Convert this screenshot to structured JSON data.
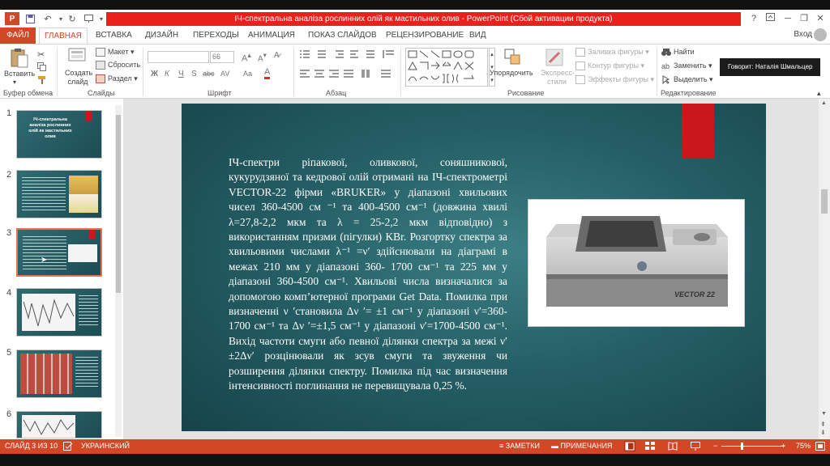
{
  "window": {
    "title": "ІЧ-спектральна аналіза рослинних олій як мастильних олив - PowerPoint (Сбой активации продукта)",
    "help": "?",
    "minimize": "─",
    "restore": "❐",
    "close": "✕"
  },
  "quick_access": {
    "save": "💾",
    "undo": "↶",
    "redo": "↻",
    "start": "▣"
  },
  "tabs": [
    "ФАЙЛ",
    "ГЛАВНАЯ",
    "ВСТАВКА",
    "ДИЗАЙН",
    "ПЕРЕХОДЫ",
    "АНИМАЦИЯ",
    "ПОКАЗ СЛАЙДОВ",
    "РЕЦЕНЗИРОВАНИЕ",
    "ВИД"
  ],
  "active_tab": "ГЛАВНАЯ",
  "login": "Вход",
  "ribbon": {
    "clipboard": {
      "paste": "Вставить",
      "group": "Буфер обмена"
    },
    "slides": {
      "new_slide": "Создать слайд",
      "layout": "Макет",
      "reset": "Сбросить",
      "section": "Раздел",
      "group": "Слайды"
    },
    "font": {
      "font_name": "",
      "font_size": "66",
      "bold": "Ж",
      "italic": "К",
      "underline": "Ч",
      "shadow": "S",
      "strike": "abc",
      "spacing": "AV",
      "case": "Aa",
      "color": "A",
      "group": "Шрифт"
    },
    "paragraph": {
      "group": "Абзац"
    },
    "drawing": {
      "arrange": "Упорядочить",
      "quick_styles": "Экспресс-стили",
      "fill": "Заливка фигуры",
      "outline": "Контур фигуры",
      "effects": "Эффекты фигуры",
      "group": "Рисование"
    },
    "editing": {
      "find": "Найти",
      "replace": "Заменить",
      "select": "Выделить",
      "group": "Редактирование"
    }
  },
  "tooltip": "Говорит: Наталія Шмальцер",
  "thumbnails": [
    {
      "num": "1",
      "text": "ІЧ-спектральна аналіза рослинних олій як мастильних олив"
    },
    {
      "num": "2"
    },
    {
      "num": "3",
      "selected": true
    },
    {
      "num": "4"
    },
    {
      "num": "5"
    },
    {
      "num": "6"
    }
  ],
  "slide": {
    "body": "ІЧ-спектри ріпакової, оливкової, соняшникової, кукурудзяної та кедрової олій отримані на ІЧ-спектрометрі VECTOR-22 фірми «BRUKER» у діапазоні хвильових чисел 360-4500 см ⁻¹ та 400-4500 см⁻¹ (довжина хвилі λ=27,8-2,2 мкм та λ = 25-2,2 мкм відповідно) з використанням призми (пігулки) KBr. Розгортку спектра за хвильовими числами λ⁻¹ =ν′ здійснювали на діаграмі в межах 210 мм у діапазоні 360- 1700 см⁻¹ та 225 мм у діапазоні 360-4500 см⁻¹. Хвильові числа визначалися за допомогою комп’ютерної програми Get Data. Помилка при визначенні ν ′становила Δν ′= ±1 см⁻¹ у діапазоні ν′=360-1700 см⁻¹ та Δν ′=±1,5 см⁻¹ у діапазоні ν′=1700-4500 см⁻¹. Вихід частоти смуги або певної ділянки спектра за межі ν′±2Δν′ розцінювали як зсув смуги та звуження чи розширення ділянки спектру. Помилка під час визначення інтенсивності поглинання не перевищувала 0,25 %.",
    "device_label": "VECTOR 22"
  },
  "status": {
    "slide_info": "СЛАЙД 3 ИЗ 10",
    "language": "УКРАИНСКИЙ",
    "notes": "ЗАМЕТКИ",
    "comments": "ПРИМЕЧАНИЯ",
    "zoom": "75%",
    "zoom_minus": "−",
    "zoom_plus": "+"
  }
}
